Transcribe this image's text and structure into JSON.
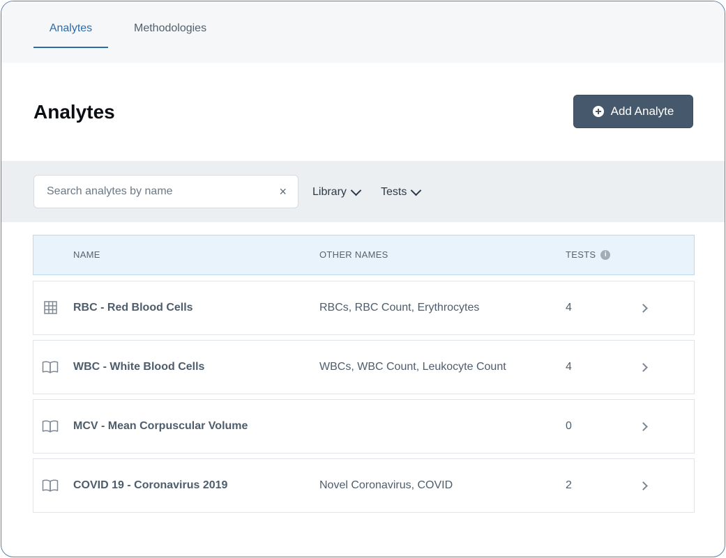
{
  "tabs": [
    {
      "label": "Analytes",
      "active": true
    },
    {
      "label": "Methodologies",
      "active": false
    }
  ],
  "header": {
    "title": "Analytes",
    "add_button_label": "Add Analyte"
  },
  "filters": {
    "search_placeholder": "Search analytes by name",
    "search_value": "",
    "clear_icon": "×",
    "library_label": "Library",
    "tests_label": "Tests"
  },
  "table": {
    "columns": {
      "name": "NAME",
      "other_names": "OTHER NAMES",
      "tests": "TESTS"
    },
    "info_glyph": "i",
    "rows": [
      {
        "icon": "table-grid-icon",
        "name": "RBC - Red Blood Cells",
        "other_names": "RBCs, RBC Count, Erythrocytes",
        "tests": "4"
      },
      {
        "icon": "book-icon",
        "name": "WBC - White Blood Cells",
        "other_names": "WBCs, WBC Count, Leukocyte Count",
        "tests": "4"
      },
      {
        "icon": "book-icon",
        "name": "MCV - Mean Corpuscular Volume",
        "other_names": "",
        "tests": "0"
      },
      {
        "icon": "book-icon",
        "name": "COVID 19 - Coronavirus 2019",
        "other_names": "Novel Coronavirus, COVID",
        "tests": "2"
      }
    ]
  },
  "colors": {
    "accent": "#2f6ba7",
    "button_bg": "#46586b",
    "header_row_bg": "#e9f3fc",
    "filter_bar_bg": "#eceff2"
  }
}
